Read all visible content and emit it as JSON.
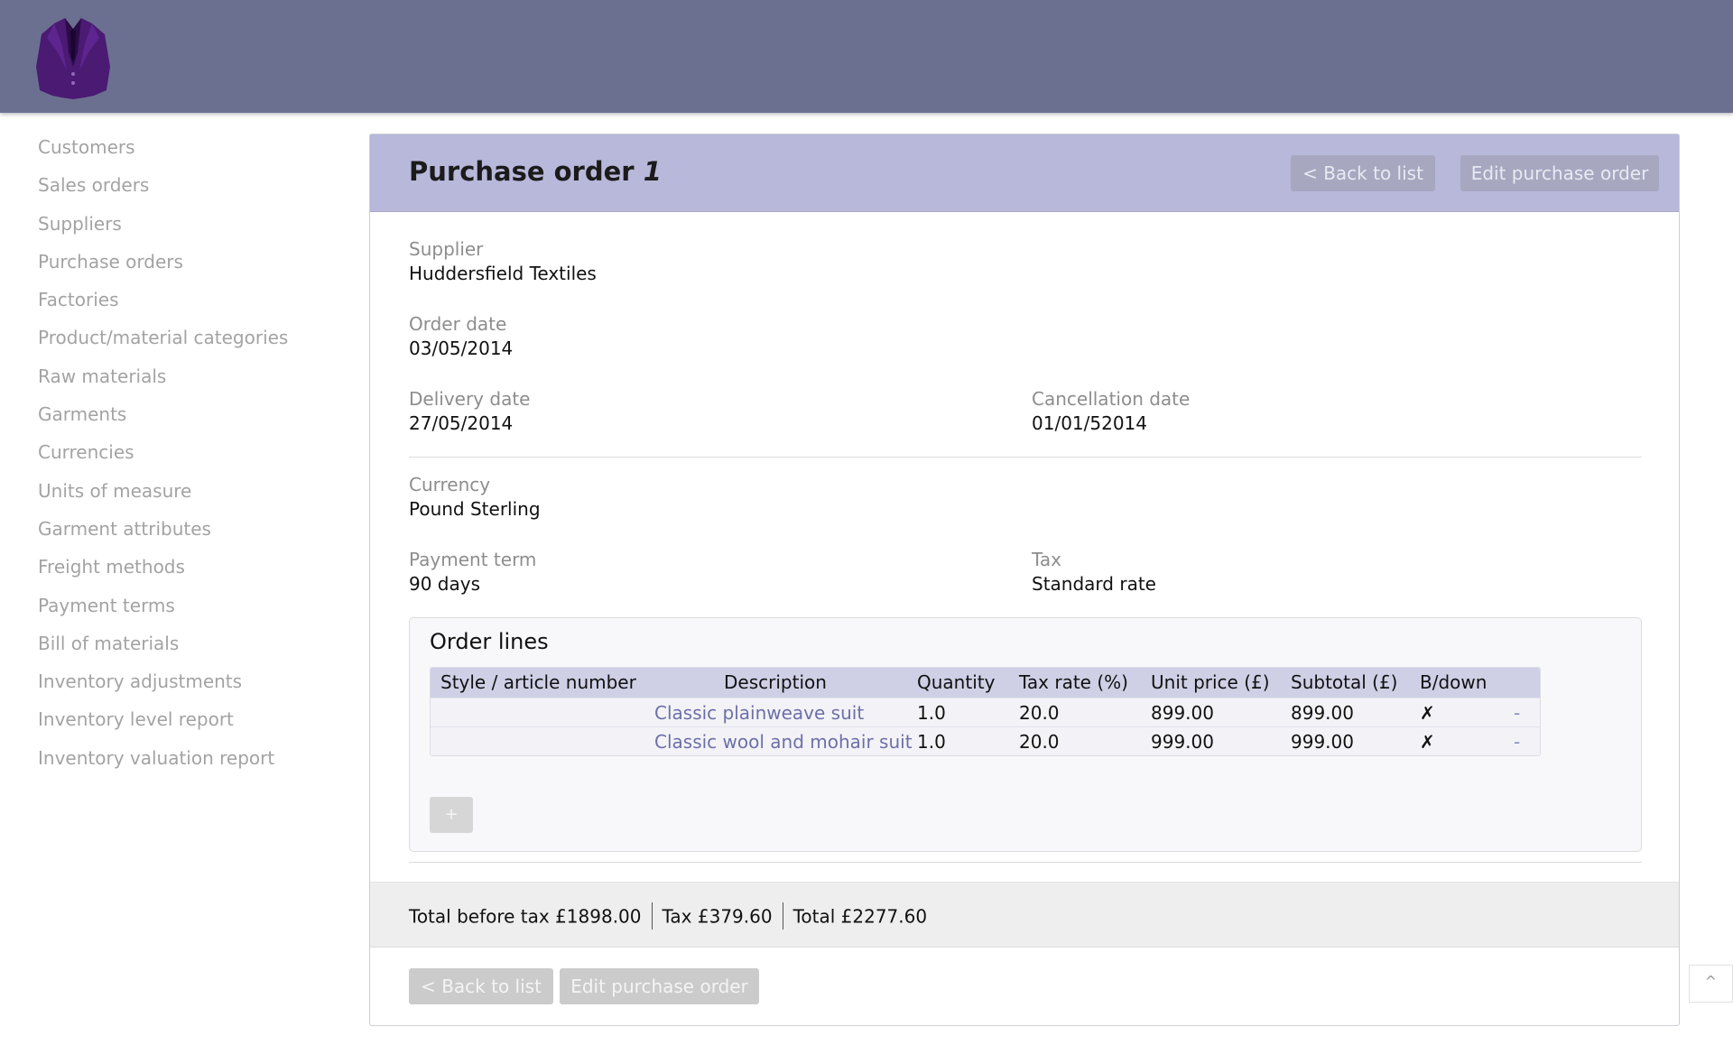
{
  "brand": {
    "logo_icon": "suit-jacket-icon",
    "logo_color": "#4b1a73"
  },
  "sidebar": {
    "items": [
      {
        "label": "Customers"
      },
      {
        "label": "Sales orders"
      },
      {
        "label": "Suppliers"
      },
      {
        "label": "Purchase orders"
      },
      {
        "label": "Factories"
      },
      {
        "label": "Product/material categories"
      },
      {
        "label": "Raw materials"
      },
      {
        "label": "Garments"
      },
      {
        "label": "Currencies"
      },
      {
        "label": "Units of measure"
      },
      {
        "label": "Garment attributes"
      },
      {
        "label": "Freight methods"
      },
      {
        "label": "Payment terms"
      },
      {
        "label": "Bill of materials"
      },
      {
        "label": "Inventory adjustments"
      },
      {
        "label": "Inventory level report"
      },
      {
        "label": "Inventory valuation report"
      }
    ]
  },
  "header": {
    "title": "Purchase order",
    "order_number": "1",
    "back_label": "< Back to list",
    "edit_label": "Edit purchase order"
  },
  "details": {
    "supplier": {
      "label": "Supplier",
      "value": "Huddersfield Textiles"
    },
    "order_date": {
      "label": "Order date",
      "value": "03/05/2014"
    },
    "delivery_date": {
      "label": "Delivery date",
      "value": "27/05/2014"
    },
    "cancellation_date": {
      "label": "Cancellation date",
      "value": "01/01/52014"
    },
    "currency": {
      "label": "Currency",
      "value": "Pound Sterling"
    },
    "payment_term": {
      "label": "Payment term",
      "value": "90 days"
    },
    "tax": {
      "label": "Tax",
      "value": "Standard rate"
    }
  },
  "order_lines": {
    "title": "Order lines",
    "columns": [
      "Style / article number",
      "Description",
      "Quantity",
      "Tax rate (%)",
      "Unit price (£)",
      "Subtotal (£)",
      "B/down"
    ],
    "rows": [
      {
        "style": "",
        "description": "Classic plainweave suit",
        "quantity": "1.0",
        "tax_rate": "20.0",
        "unit_price": "899.00",
        "subtotal": "899.00",
        "breakdown": "✗",
        "remove": "-"
      },
      {
        "style": "",
        "description": "Classic wool and mohair suit",
        "quantity": "1.0",
        "tax_rate": "20.0",
        "unit_price": "999.00",
        "subtotal": "999.00",
        "breakdown": "✗",
        "remove": "-"
      }
    ],
    "add_label": "+"
  },
  "totals": {
    "before_tax": "Total before tax £1898.00",
    "tax": "Tax £379.60",
    "total": "Total £2277.60"
  },
  "footer": {
    "back_label": "< Back to list",
    "edit_label": "Edit purchase order"
  },
  "scroll_top": {
    "icon": "caret-up-icon",
    "label": "^"
  },
  "colors": {
    "topbar": "#6c7090",
    "panel_header": "#b7b8da",
    "link": "#6c6fa8",
    "sidebar_text": "#a3a3a3"
  }
}
